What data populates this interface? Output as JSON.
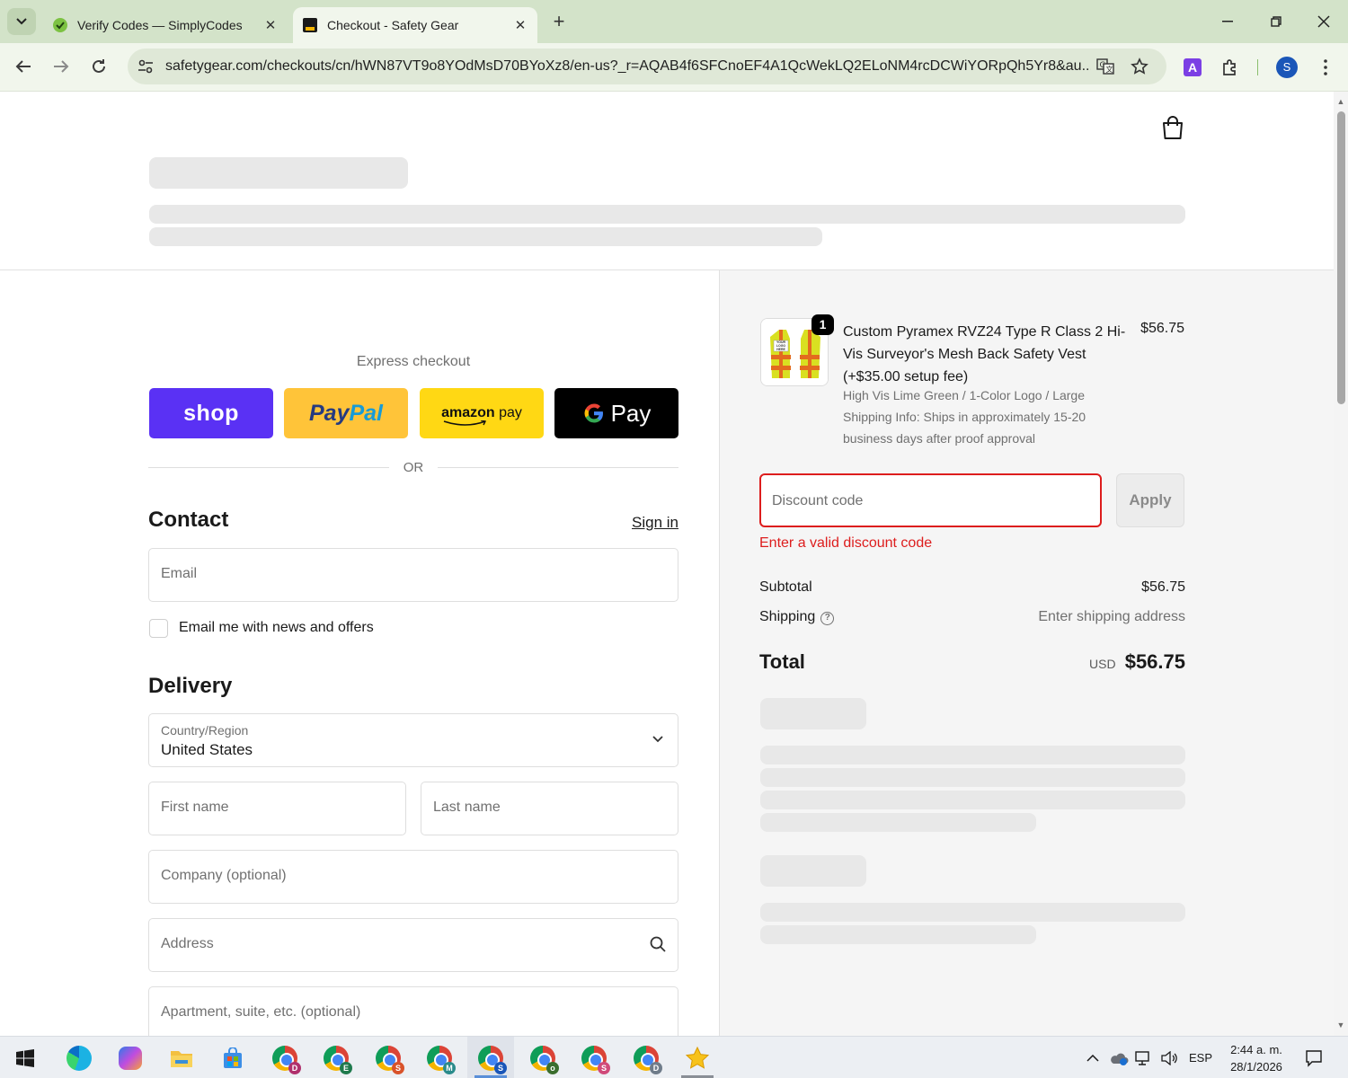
{
  "browser": {
    "tabs": [
      {
        "title": "Verify Codes — SimplyCodes",
        "active": false
      },
      {
        "title": "Checkout - Safety Gear",
        "active": true
      }
    ],
    "url": "safetygear.com/checkouts/cn/hWN87VT9o8YOdMsD70BYoXz8/en-us?_r=AQAB4f6SFCnoEF4A1QcWekLQ2ELoNM4rcDCWiYORpQh5Yr8&au...",
    "profile_initial": "S",
    "extension_initial": "A"
  },
  "checkout": {
    "express_label": "Express checkout",
    "pay_buttons": {
      "shop": "shop",
      "paypal_a": "Pay",
      "paypal_b": "Pal",
      "amazon_a": "amazon",
      "amazon_b": "pay",
      "gpay": "Pay"
    },
    "or_label": "OR",
    "contact": {
      "title": "Contact",
      "signin_label": "Sign in",
      "email_placeholder": "Email",
      "newsletter_label": "Email me with news and offers"
    },
    "delivery": {
      "title": "Delivery",
      "country_label": "Country/Region",
      "country_value": "United States",
      "first_name_placeholder": "First name",
      "last_name_placeholder": "Last name",
      "company_placeholder": "Company (optional)",
      "address_placeholder": "Address",
      "apartment_placeholder": "Apartment, suite, etc. (optional)"
    }
  },
  "summary": {
    "product": {
      "quantity": "1",
      "name": "Custom Pyramex RVZ24 Type R Class 2 Hi-Vis Surveyor's Mesh Back Safety Vest (+$35.00 setup fee)",
      "variant": "High Vis Lime Green / 1-Color Logo / Large",
      "shipping_info": "Shipping Info: Ships in approximately 15-20 business days after proof approval",
      "price": "$56.75",
      "thumb_text": "YOUR LOGO HERE"
    },
    "discount": {
      "placeholder": "Discount code",
      "apply_label": "Apply",
      "error": "Enter a valid discount code"
    },
    "subtotal_label": "Subtotal",
    "subtotal_value": "$56.75",
    "shipping_label": "Shipping",
    "shipping_value": "Enter shipping address",
    "total_label": "Total",
    "total_currency": "USD",
    "total_value": "$56.75"
  },
  "taskbar": {
    "apps": [
      "D",
      "E",
      "S",
      "M",
      "S",
      "o",
      "S",
      "D"
    ],
    "language": "ESP",
    "time": "2:44 a. m.",
    "date": "28/1/2026"
  },
  "colors": {
    "shop_pay": "#5a31f4",
    "paypal": "#ffc439",
    "amazon_pay": "#ffd814",
    "google_pay": "#000000",
    "error": "#dd1d1d"
  }
}
